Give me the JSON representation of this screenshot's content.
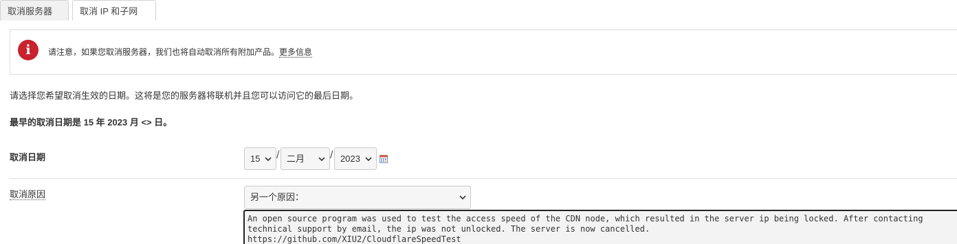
{
  "tabs": [
    {
      "label": "取消服务器",
      "active": true
    },
    {
      "label": "取消 IP 和子网",
      "active": false
    }
  ],
  "alert": {
    "icon": "info-icon",
    "icon_glyph": "i",
    "color": "#c9222e",
    "text": "请注意，如果您取消服务器，我们也将自动取消所有附加产品。",
    "link": "更多信息"
  },
  "instruction": "请选择您希望取消生效的日期。这将是您的服务器将联机并且您可以访问它的最后日期。",
  "earliest": "最早的取消日期是 15 年 2023 月 <> 日。",
  "form": {
    "date_label": "取消日期",
    "day": "15",
    "month": "二月",
    "year": "2023",
    "separator": "/",
    "calendar_icon": "calendar-icon",
    "reason_label": "取消原因",
    "reason_selected": "另一个原因：",
    "reason_text": "An open source program was used to test the access speed of the CDN node, which resulted in the server ip being locked. After contacting technical support by email, the ip was not unlocked. The server is now cancelled.\nhttps://github.com/XIU2/CloudflareSpeedTest"
  }
}
